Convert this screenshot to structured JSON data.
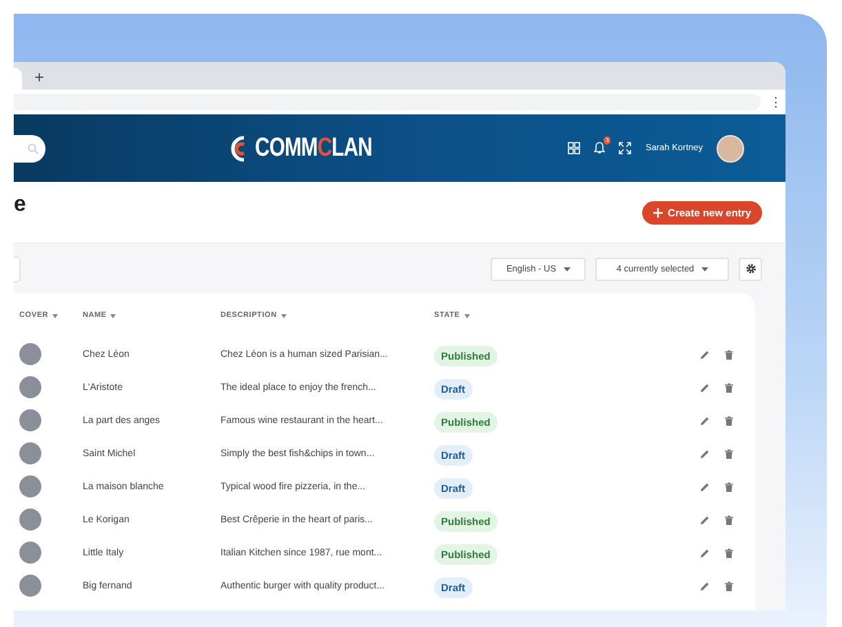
{
  "browser": {
    "new_tab": "+",
    "menu": "⋮"
  },
  "header": {
    "logo": [
      {
        "text": "COMM",
        "accent": false
      },
      {
        "text": "C",
        "accent": true
      },
      {
        "text": "LAN",
        "accent": false
      }
    ],
    "notifications": "3",
    "user_name": "Sarah Kortney"
  },
  "page": {
    "title": "e",
    "create_button": "Create new entry"
  },
  "toolbar": {
    "locale": "English - US",
    "columns": "4 currently selected"
  },
  "table": {
    "columns": [
      "COVER",
      "NAME",
      "DESCRIPTION",
      "STATE"
    ],
    "rows": [
      {
        "name": "Chez Léon",
        "description": "Chez Léon is a human sized Parisian...",
        "state": {
          "label": "Published",
          "kind": "published"
        }
      },
      {
        "name": "L'Aristote",
        "description": "The ideal place to enjoy the french...",
        "state": {
          "label": "Draft",
          "kind": "draft"
        }
      },
      {
        "name": "La part des anges",
        "description": "Famous wine restaurant in the heart...",
        "state": {
          "label": "Published",
          "kind": "published"
        }
      },
      {
        "name": "Saint Michel",
        "description": "Simply the best fish&chips in town...",
        "state": {
          "label": "Draft",
          "kind": "draft"
        }
      },
      {
        "name": "La maison blanche",
        "description": "Typical wood fire pizzeria, in the...",
        "state": {
          "label": "Draft",
          "kind": "draft"
        }
      },
      {
        "name": "Le Korigan",
        "description": "Best Crêperie in the heart of paris...",
        "state": {
          "label": "Published",
          "kind": "published"
        }
      },
      {
        "name": "Little Italy",
        "description": "Italian Kitchen since 1987, rue mont...",
        "state": {
          "label": "Published",
          "kind": "published"
        }
      },
      {
        "name": "Big fernand",
        "description": "Authentic burger with quality product...",
        "state": {
          "label": "Draft",
          "kind": "draft"
        }
      }
    ]
  }
}
